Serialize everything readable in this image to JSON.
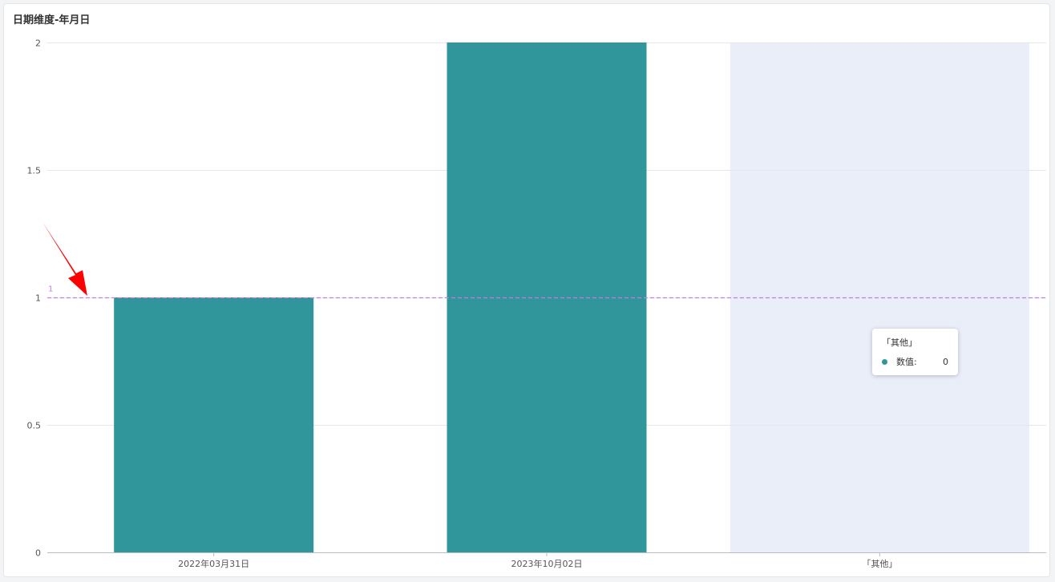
{
  "card": {
    "title": "日期维度-年月日"
  },
  "colors": {
    "bar": "#31969c",
    "highlight_band": "#eaeef8",
    "reference_line": "#c27fe0",
    "grid": "#e4e6ea",
    "axis": "#b8bcc4",
    "tick_text": "#555555",
    "arrow": "#ff0000"
  },
  "chart_data": {
    "type": "bar",
    "categories": [
      "2022年03月31日",
      "2023年10月02日",
      "「其他」"
    ],
    "values": [
      1,
      2,
      0
    ],
    "ylim": [
      0,
      2
    ],
    "yticks": [
      "0",
      "0.5",
      "1",
      "1.5",
      "2"
    ],
    "grid": true,
    "reference_line": {
      "value": 1,
      "label": "1",
      "style": "dashed"
    },
    "highlighted_category": "「其他」",
    "tooltip": {
      "title": "「其他」",
      "series_label": "数值:",
      "value": "0"
    },
    "annotation": {
      "icon": "red-arrow-icon",
      "points_to": "reference-line-label"
    }
  }
}
